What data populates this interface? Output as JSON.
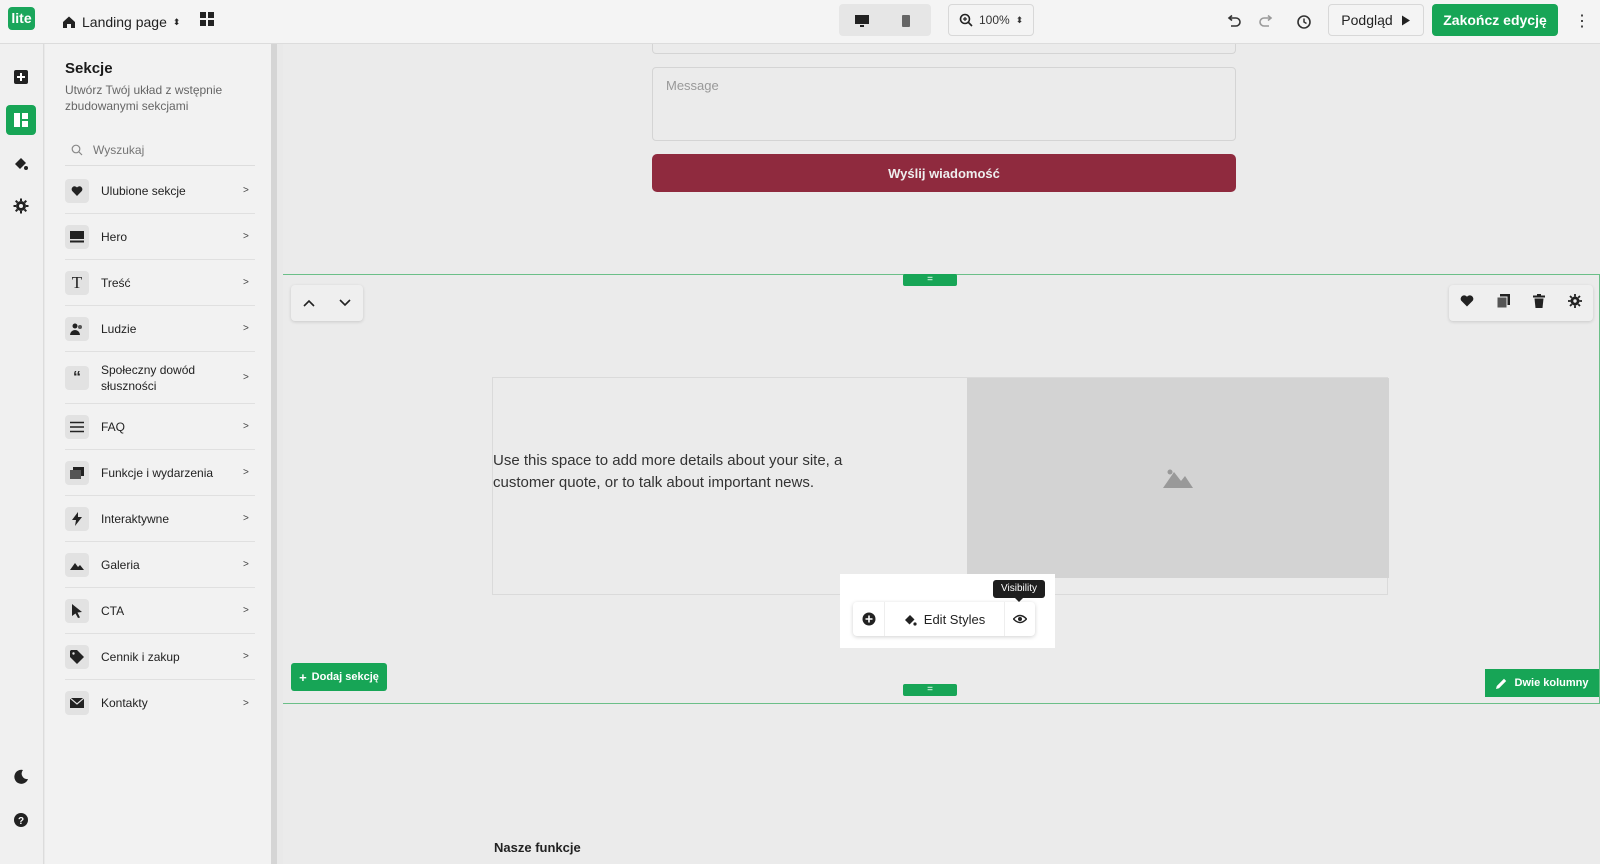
{
  "topbar": {
    "logo": "lite",
    "page_name": "Landing page",
    "zoom": "100%",
    "preview_label": "Podgląd",
    "finish_label": "Zakończ edycję"
  },
  "panel": {
    "title": "Sekcje",
    "subtitle": "Utwórz Twój układ z wstępnie zbudowanymi sekcjami",
    "search_placeholder": "Wyszukaj",
    "categories": [
      {
        "label": "Ulubione sekcje",
        "icon": "heart-icon"
      },
      {
        "label": "Hero",
        "icon": "hero-icon"
      },
      {
        "label": "Treść",
        "icon": "text-icon"
      },
      {
        "label": "Ludzie",
        "icon": "people-icon"
      },
      {
        "label": "Społeczny dowód słuszności",
        "icon": "quote-icon"
      },
      {
        "label": "FAQ",
        "icon": "list-icon"
      },
      {
        "label": "Funkcje i wydarzenia",
        "icon": "features-icon"
      },
      {
        "label": "Interaktywne",
        "icon": "bolt-icon"
      },
      {
        "label": "Galeria",
        "icon": "image-icon"
      },
      {
        "label": "CTA",
        "icon": "cursor-icon"
      },
      {
        "label": "Cennik i zakup",
        "icon": "tag-icon"
      },
      {
        "label": "Kontakty",
        "icon": "mail-icon"
      }
    ]
  },
  "canvas": {
    "message_placeholder": "Message",
    "send_label": "Wyślij wiadomość",
    "section_text": "Use this space to add more details about your site, a customer quote, or to talk about important news.",
    "add_section_label": "Dodaj sekcję",
    "layout_label": "Dwie kolumny",
    "next_section_title": "Nasze funkcje"
  },
  "popover": {
    "edit_label": "Edit Styles",
    "tooltip": "Visibility"
  },
  "colors": {
    "brand_green": "#17a556",
    "send_button": "#8f2a3e"
  }
}
